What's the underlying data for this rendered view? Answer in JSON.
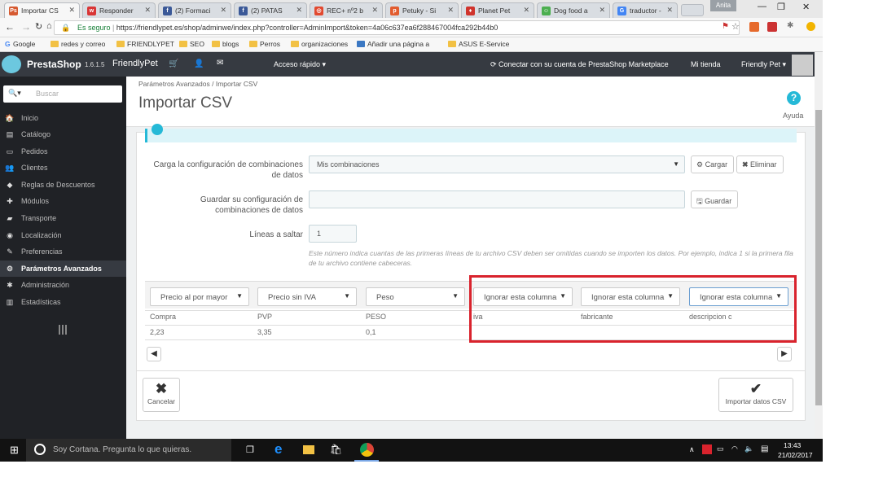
{
  "browser": {
    "tabs": [
      {
        "label": "Importar CS",
        "fav": "Ps",
        "color": "#d65a31",
        "active": true
      },
      {
        "label": "Responder",
        "fav": "w",
        "color": "#d93636"
      },
      {
        "label": "(2) Formaci",
        "fav": "f",
        "color": "#3b5998"
      },
      {
        "label": "(2) PATAS",
        "fav": "f",
        "color": "#3b5998"
      },
      {
        "label": "REC+ nº2 b",
        "fav": "◎",
        "color": "#e2492f"
      },
      {
        "label": "Petuky - Si",
        "fav": "p",
        "color": "#e25c2f"
      },
      {
        "label": "Planet Pet",
        "fav": "♦",
        "color": "#d0342c"
      },
      {
        "label": "Dog food a",
        "fav": "☺",
        "color": "#4caf50"
      },
      {
        "label": "traductor -",
        "fav": "G",
        "color": "#4285f4"
      }
    ],
    "user_badge": "Anita",
    "secure_label": "Es seguro",
    "url": "https://friendlypet.es/shop/adminwe/index.php?controller=AdminImport&token=4a06c637ea6f288467004fca292b44b0",
    "bookmarks": [
      "Google",
      "redes y correo",
      "FRIENDLYPET",
      "SEO",
      "blogs",
      "Perros",
      "organizaciones",
      "Añadir una página a",
      "ASUS E-Service"
    ]
  },
  "header": {
    "brand": "PrestaShop",
    "version": "1.6.1.5",
    "shop": "FriendlyPet",
    "quick_access": "Acceso rápido ▾",
    "marketplace": "Conectar con su cuenta de PrestaShop Marketplace",
    "my_shop": "Mi tienda",
    "user": "Friendly Pet ▾"
  },
  "sidebar": {
    "search_placeholder": "Buscar",
    "items": [
      {
        "label": "Inicio",
        "icon": "🏠"
      },
      {
        "label": "Catálogo",
        "icon": "▤"
      },
      {
        "label": "Pedidos",
        "icon": "▭"
      },
      {
        "label": "Clientes",
        "icon": "👥"
      },
      {
        "label": "Reglas de Descuentos",
        "icon": "◆"
      },
      {
        "label": "Módulos",
        "icon": "✚"
      },
      {
        "label": "Transporte",
        "icon": "▰"
      },
      {
        "label": "Localización",
        "icon": "◉"
      },
      {
        "label": "Preferencias",
        "icon": "✎"
      },
      {
        "label": "Parámetros Avanzados",
        "icon": "⚙",
        "active": true
      },
      {
        "label": "Administración",
        "icon": "✱"
      },
      {
        "label": "Estadísticas",
        "icon": "▥"
      }
    ]
  },
  "page": {
    "breadcrumb_parent": "Parámetros Avanzados",
    "breadcrumb_sep": "/",
    "breadcrumb_current": "Importar CSV",
    "title": "Importar CSV",
    "help": "Ayuda"
  },
  "form": {
    "load_label": "Carga la configuración de combinaciones de datos",
    "load_value": "Mis combinaciones",
    "load_button": "Cargar",
    "delete_button": "Eliminar",
    "save_label": "Guardar su configuración de combinaciones de datos",
    "save_value": "",
    "save_button": "Guardar",
    "skip_label": "Líneas a saltar",
    "skip_value": "1",
    "skip_help": "Este número indica cuantas de las primeras líneas de tu archivo CSV deben ser omitidas cuando se importen los datos. Por ejemplo, indica 1 si la primera fila de tu archivo contiene cabeceras."
  },
  "mapping": {
    "selects": [
      "Precio al por mayor",
      "Precio sin IVA",
      "Peso",
      "Ignorar esta columna",
      "Ignorar esta columna",
      "Ignorar esta columna"
    ],
    "headers": [
      "Compra",
      "PVP",
      "PESO",
      "iva",
      "fabricante",
      "descripcion c"
    ],
    "row": [
      "2,23",
      "3,35",
      "0,1",
      "",
      "",
      ""
    ],
    "highlight_color": "#d9232d"
  },
  "actions": {
    "cancel": "Cancelar",
    "import": "Importar datos CSV"
  },
  "taskbar": {
    "cortana": "Soy Cortana. Pregunta lo que quieras.",
    "time": "13:43",
    "date": "21/02/2017"
  }
}
